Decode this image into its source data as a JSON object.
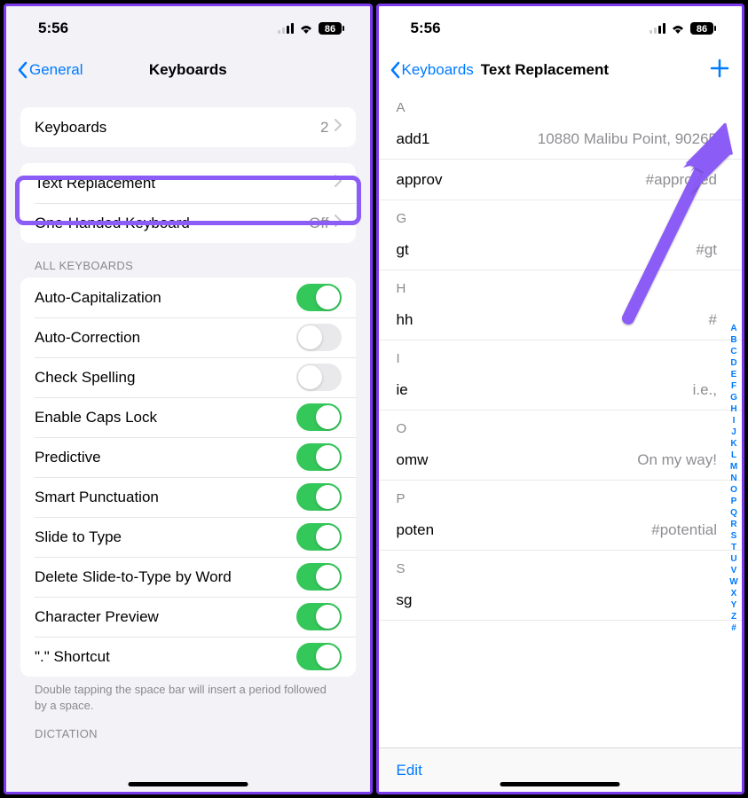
{
  "status": {
    "time": "5:56",
    "battery": "86"
  },
  "left": {
    "nav": {
      "back": "General",
      "title": "Keyboards"
    },
    "rows": {
      "keyboards": {
        "label": "Keyboards",
        "count": "2"
      },
      "text_replacement": {
        "label": "Text Replacement"
      },
      "one_handed": {
        "label": "One-Handed Keyboard",
        "value": "Off"
      }
    },
    "section_all": "ALL KEYBOARDS",
    "toggles": [
      {
        "label": "Auto-Capitalization",
        "on": true
      },
      {
        "label": "Auto-Correction",
        "on": false
      },
      {
        "label": "Check Spelling",
        "on": false
      },
      {
        "label": "Enable Caps Lock",
        "on": true
      },
      {
        "label": "Predictive",
        "on": true
      },
      {
        "label": "Smart Punctuation",
        "on": true
      },
      {
        "label": "Slide to Type",
        "on": true
      },
      {
        "label": "Delete Slide-to-Type by Word",
        "on": true
      },
      {
        "label": "Character Preview",
        "on": true
      },
      {
        "label": "\".\" Shortcut",
        "on": true
      }
    ],
    "footer": "Double tapping the space bar will insert a period followed by a space.",
    "section_dictation": "DICTATION"
  },
  "right": {
    "nav": {
      "back": "Keyboards",
      "title": "Text Replacement"
    },
    "sections": [
      {
        "letter": "A",
        "items": [
          {
            "shortcut": "add1",
            "phrase": "10880 Malibu Point, 90265"
          },
          {
            "shortcut": "approv",
            "phrase": "#approved"
          }
        ]
      },
      {
        "letter": "G",
        "items": [
          {
            "shortcut": "gt",
            "phrase": "#gt"
          }
        ]
      },
      {
        "letter": "H",
        "items": [
          {
            "shortcut": "hh",
            "phrase": "#"
          }
        ]
      },
      {
        "letter": "I",
        "items": [
          {
            "shortcut": "ie",
            "phrase": "i.e.,"
          }
        ]
      },
      {
        "letter": "O",
        "items": [
          {
            "shortcut": "omw",
            "phrase": "On my way!"
          }
        ]
      },
      {
        "letter": "P",
        "items": [
          {
            "shortcut": "poten",
            "phrase": "#potential"
          }
        ]
      },
      {
        "letter": "S",
        "items": [
          {
            "shortcut": "sg",
            "phrase": ""
          }
        ]
      }
    ],
    "index_letters": [
      "A",
      "B",
      "C",
      "D",
      "E",
      "F",
      "G",
      "H",
      "I",
      "J",
      "K",
      "L",
      "M",
      "N",
      "O",
      "P",
      "Q",
      "R",
      "S",
      "T",
      "U",
      "V",
      "W",
      "X",
      "Y",
      "Z",
      "#"
    ],
    "toolbar": {
      "edit": "Edit"
    }
  }
}
